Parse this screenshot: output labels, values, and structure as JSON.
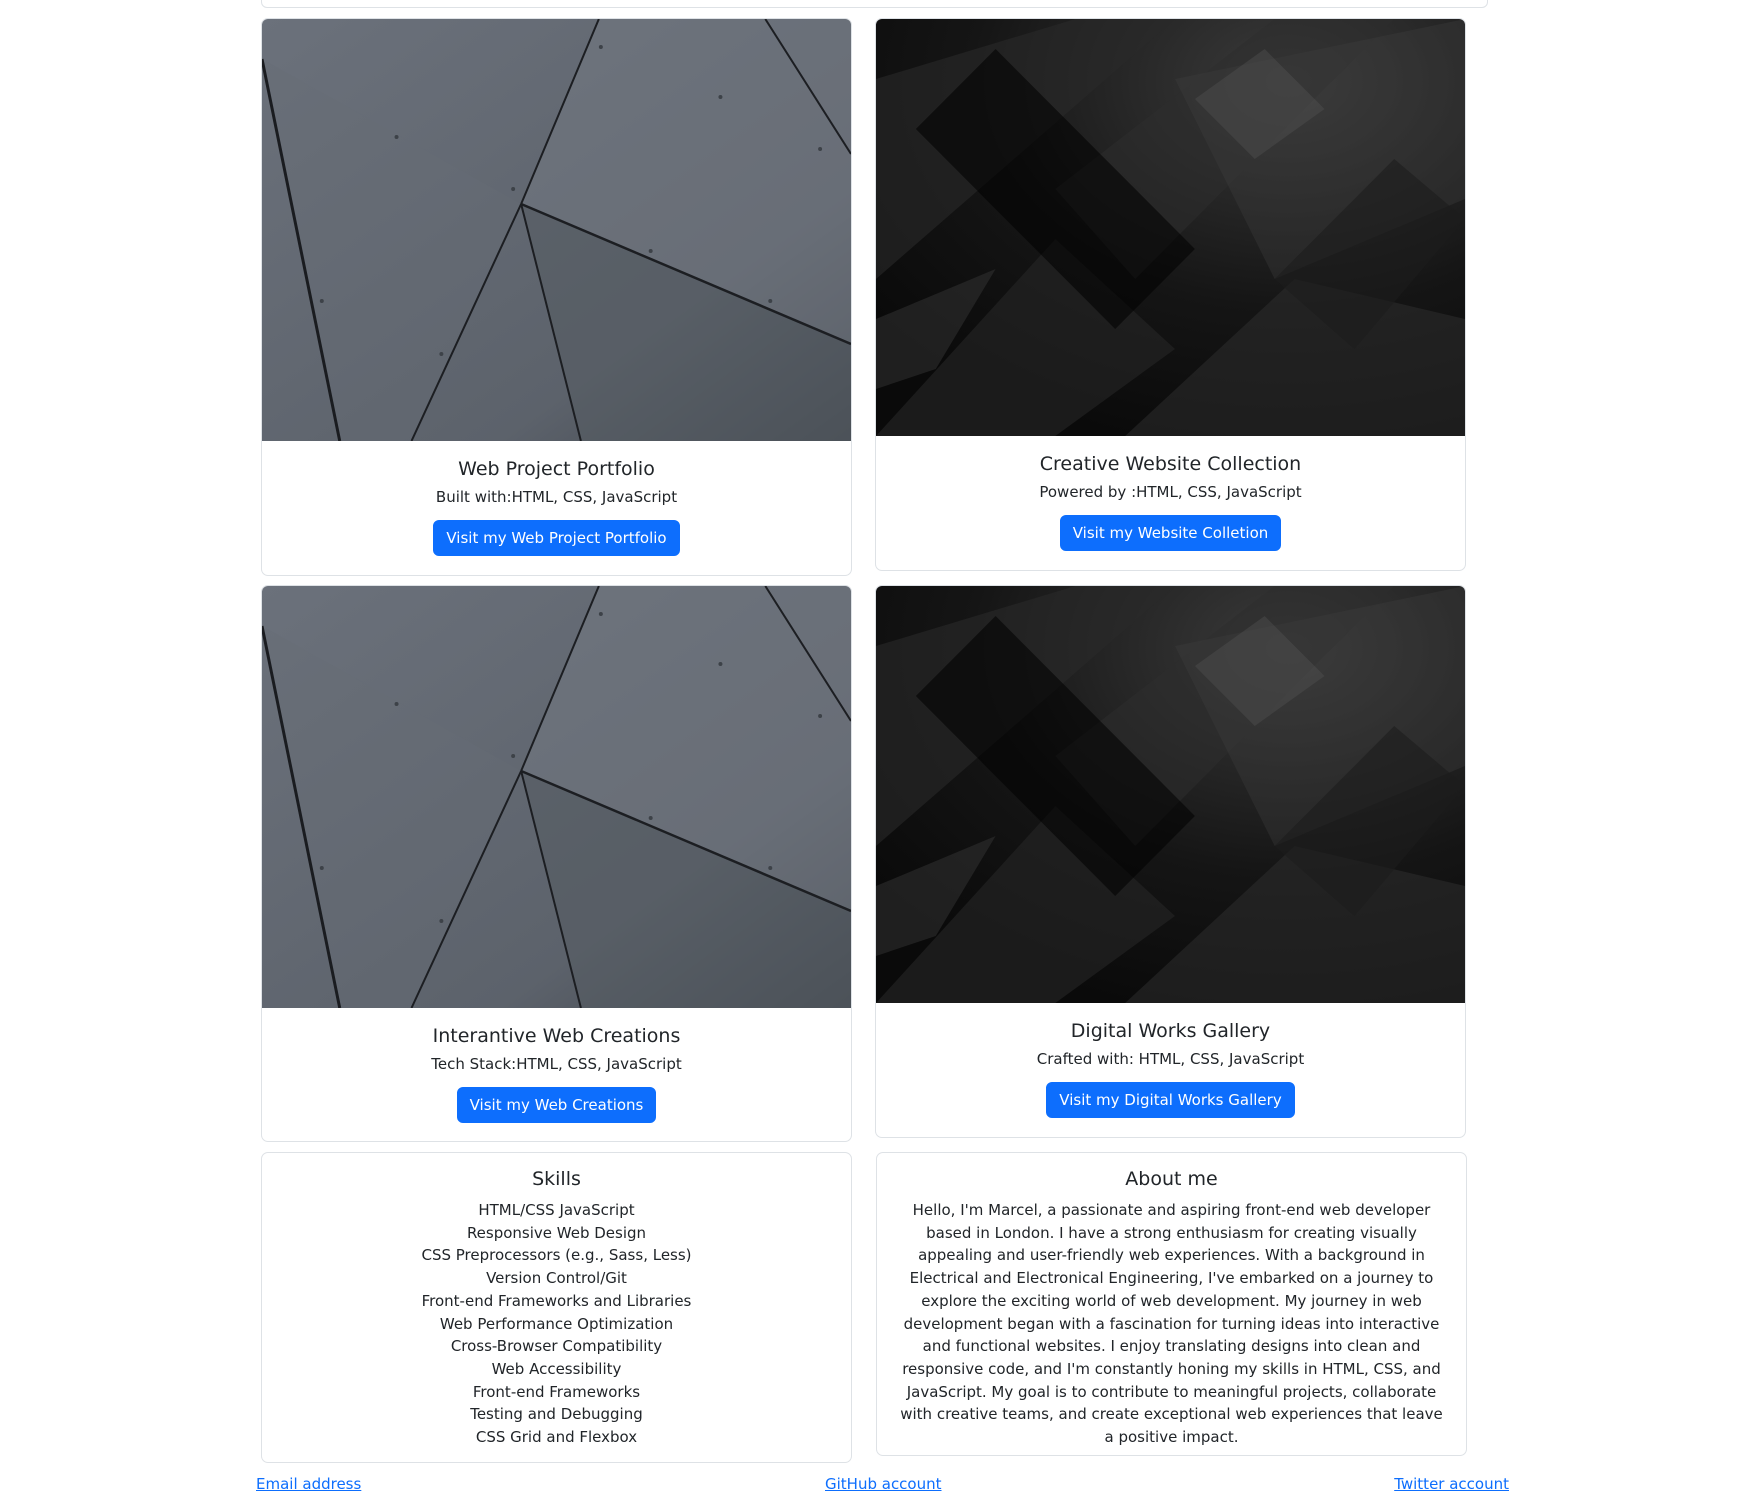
{
  "projects": [
    {
      "title": "Web Project Portfolio",
      "subtitle": "Built with:HTML, CSS, JavaScript",
      "button": "Visit my Web Project Portfolio",
      "image": "grey-geometric-panels"
    },
    {
      "title": "Creative Website Collection",
      "subtitle": "Powered by :HTML, CSS, JavaScript",
      "button": "Visit my Website Colletion",
      "image": "dark-abstract-chevrons"
    },
    {
      "title": "Interantive Web Creations",
      "subtitle": "Tech Stack:HTML, CSS, JavaScript",
      "button": "Visit my Web Creations",
      "image": "grey-geometric-panels"
    },
    {
      "title": "Digital Works Gallery",
      "subtitle": "Crafted with: HTML, CSS, JavaScript",
      "button": "Visit my Digital Works Gallery",
      "image": "dark-abstract-chevrons"
    }
  ],
  "skills": {
    "title": "Skills",
    "items": [
      "HTML/CSS JavaScript",
      "Responsive Web Design",
      "CSS Preprocessors (e.g., Sass, Less)",
      "Version Control/Git",
      "Front-end Frameworks and Libraries",
      "Web Performance Optimization",
      "Cross-Browser Compatibility",
      "Web Accessibility",
      "Front-end Frameworks",
      "Testing and Debugging",
      "CSS Grid and Flexbox"
    ]
  },
  "about": {
    "title": "About me",
    "text": "Hello, I'm Marcel, a passionate and aspiring front-end web developer based in London. I have a strong enthusiasm for creating visually appealing and user-friendly web experiences. With a background in Electrical and Electronical Engineering, I've embarked on a journey to explore the exciting world of web development. My journey in web development began with a fascination for turning ideas into interactive and functional websites. I enjoy translating designs into clean and responsive code, and I'm constantly honing my skills in HTML, CSS, and JavaScript. My goal is to contribute to meaningful projects, collaborate with creative teams, and create exceptional web experiences that leave a positive impact."
  },
  "footer": {
    "email": "Email address",
    "github": "GitHub account",
    "twitter": "Twitter account"
  },
  "colors": {
    "primary": "#0d6efd",
    "border": "#dee2e6",
    "text": "#212529"
  }
}
